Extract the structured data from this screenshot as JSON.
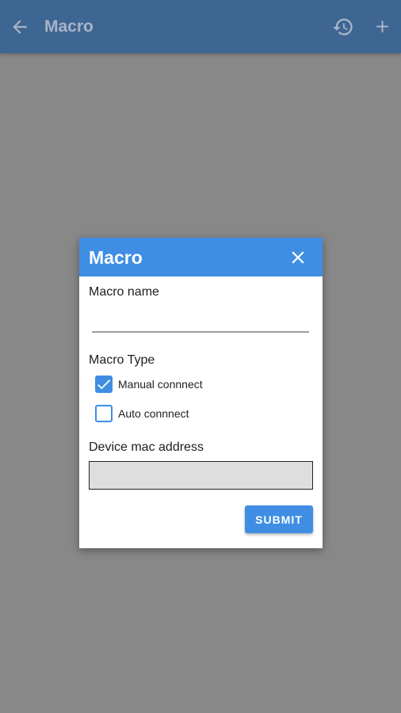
{
  "appbar": {
    "title": "Macro",
    "icons": [
      "back-arrow-icon",
      "history-icon",
      "add-icon"
    ],
    "color": "#3e6693"
  },
  "dialog": {
    "title": "Macro",
    "header_color": "#3f8ee3",
    "macro_name_label": "Macro name",
    "macro_name_value": "",
    "macro_type_label": "Macro Type",
    "options": [
      {
        "label": "Manual connnect",
        "checked": true
      },
      {
        "label": "Auto connnect",
        "checked": false
      }
    ],
    "mac_label": "Device mac address",
    "mac_value": "",
    "submit_label": "SUBMIT"
  }
}
